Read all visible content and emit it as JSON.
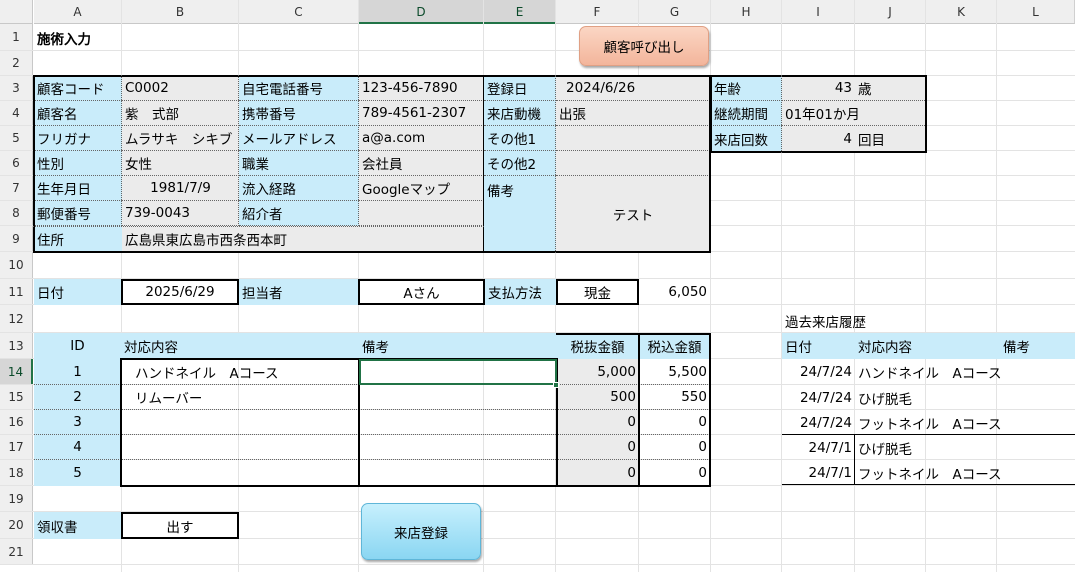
{
  "columns": [
    "A",
    "B",
    "C",
    "D",
    "E",
    "F",
    "G",
    "H",
    "I",
    "J",
    "K",
    "L"
  ],
  "rows": [
    "1",
    "2",
    "3",
    "4",
    "5",
    "6",
    "7",
    "8",
    "9",
    "10",
    "11",
    "12",
    "13",
    "14",
    "15",
    "16",
    "17",
    "18",
    "19",
    "20",
    "21"
  ],
  "title": "施術入力",
  "buttons": {
    "call_customer": "顧客呼び出し",
    "register_visit": "来店登録"
  },
  "customer": {
    "code_label": "顧客コード",
    "code": "C0002",
    "name_label": "顧客名",
    "name": "紫　式部",
    "kana_label": "フリガナ",
    "kana": "ムラサキ　シキブ",
    "gender_label": "性別",
    "gender": "女性",
    "birth_label": "生年月日",
    "birth": "1981/7/9",
    "zip_label": "郵便番号",
    "zip": "739-0043",
    "address_label": "住所",
    "address": "広島県東広島市西条西本町",
    "home_phone_label": "自宅電話番号",
    "home_phone": "123-456-7890",
    "mobile_label": "携帯番号",
    "mobile": "789-4561-2307",
    "email_label": "メールアドレス",
    "email": "a@a.com",
    "job_label": "職業",
    "job": "会社員",
    "source_label": "流入経路",
    "source": "Googleマップ",
    "referrer_label": "紹介者",
    "referrer": "",
    "reg_date_label": "登録日",
    "reg_date": "2024/6/26",
    "motive_label": "来店動機",
    "motive": "出張",
    "other1_label": "その他1",
    "other1": "",
    "other2_label": "その他2",
    "other2": "",
    "note_label": "備考",
    "note": "テスト"
  },
  "stats": {
    "age_label": "年齢",
    "age": "43",
    "age_unit": "歳",
    "duration_label": "継続期間",
    "duration": "01年01か月",
    "visits_label": "来店回数",
    "visits": "4",
    "visits_unit": "回目"
  },
  "visit": {
    "date_label": "日付",
    "date": "2025/6/29",
    "staff_label": "担当者",
    "staff": "Aさん",
    "payment_label": "支払方法",
    "payment": "現金",
    "total": "6,050"
  },
  "services_table": {
    "headers": {
      "id": "ID",
      "content": "対応内容",
      "note": "備考",
      "ex_tax": "税抜金額",
      "in_tax": "税込金額"
    },
    "rows": [
      {
        "id": "1",
        "content": "ハンドネイル　Aコース",
        "note": "",
        "ex_tax": "5,000",
        "in_tax": "5,500"
      },
      {
        "id": "2",
        "content": "リムーバー",
        "note": "",
        "ex_tax": "500",
        "in_tax": "550"
      },
      {
        "id": "3",
        "content": "",
        "note": "",
        "ex_tax": "0",
        "in_tax": "0"
      },
      {
        "id": "4",
        "content": "",
        "note": "",
        "ex_tax": "0",
        "in_tax": "0"
      },
      {
        "id": "5",
        "content": "",
        "note": "",
        "ex_tax": "0",
        "in_tax": "0"
      }
    ]
  },
  "receipt": {
    "label": "領収書",
    "value": "出す"
  },
  "history": {
    "title": "過去来店履歴",
    "headers": {
      "date": "日付",
      "content": "対応内容",
      "note": "備考"
    },
    "rows": [
      {
        "date": "24/7/24",
        "content": "ハンドネイル　Aコース"
      },
      {
        "date": "24/7/24",
        "content": "ひげ脱毛"
      },
      {
        "date": "24/7/24",
        "content": "フットネイル　Aコース"
      },
      {
        "date": "24/7/1",
        "content": "ひげ脱毛"
      },
      {
        "date": "24/7/1",
        "content": "フットネイル　Aコース"
      }
    ]
  },
  "colors": {
    "label_blue": "#c9ecfa",
    "value_gray": "#ebebeb",
    "selection_green": "#217346",
    "button_peach": "#f3b59b",
    "button_cyan": "#8ad6f2"
  }
}
